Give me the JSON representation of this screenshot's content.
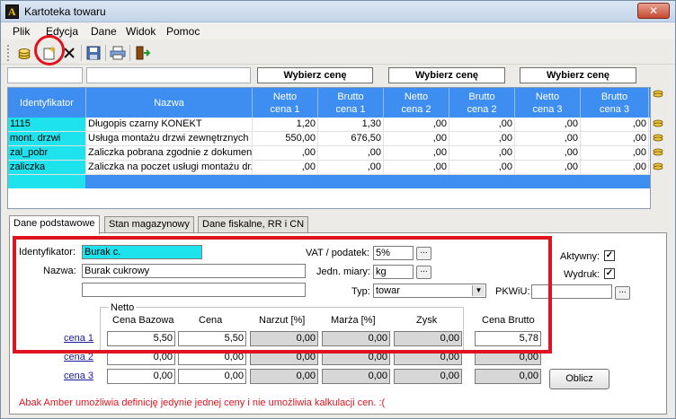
{
  "window": {
    "title": "Kartoteka towaru",
    "close_glyph": "✕"
  },
  "menu": [
    "Plik",
    "Edycja",
    "Dane",
    "Widok",
    "Pomoc"
  ],
  "toolbar": {
    "icons": [
      "coins-icon",
      "new-item-icon",
      "delete-icon",
      "save-icon",
      "print-icon",
      "exit-icon"
    ]
  },
  "price_buttons": [
    "Wybierz cenę",
    "Wybierz cenę",
    "Wybierz cenę"
  ],
  "grid": {
    "headers": [
      "Identyfikator",
      "Nazwa",
      "Netto\ncena 1",
      "Brutto\ncena 1",
      "Netto\ncena 2",
      "Brutto\ncena 2",
      "Netto\ncena 3",
      "Brutto\ncena 3"
    ],
    "rows": [
      [
        "1115",
        "Długopis czarny KONEKT",
        "1,20",
        "1,30",
        ",00",
        ",00",
        ",00",
        ",00"
      ],
      [
        "mont. drzwi",
        "Usługa montażu drzwi zewnętrznych",
        "550,00",
        "676,50",
        ",00",
        ",00",
        ",00",
        ",00"
      ],
      [
        "zal_pobr",
        "Zaliczka pobrana zgodnie z dokumente",
        ",00",
        ",00",
        ",00",
        ",00",
        ",00",
        ",00"
      ],
      [
        "zaliczka",
        "Zaliczka na poczet usługi montażu drzw",
        ",00",
        ",00",
        ",00",
        ",00",
        ",00",
        ",00"
      ]
    ]
  },
  "tabs": [
    "Dane podstawowe",
    "Stan magazynowy",
    "Dane fiskalne, RR i CN"
  ],
  "form": {
    "id_label": "Identyfikator:",
    "id_value": "Burak c.",
    "name_label": "Nazwa:",
    "name_value": "Burak cukrowy",
    "extra_value": "",
    "vat_label": "VAT / podatek:",
    "vat_value": "5%",
    "unit_label": "Jedn. miary:",
    "unit_value": "kg",
    "type_label": "Typ:",
    "type_value": "towar",
    "pkwiu_label": "PKWiU:",
    "pkwiu_value": "",
    "active_label": "Aktywny:",
    "print_label": "Wydruk:",
    "active_checked": true,
    "print_checked": true,
    "dots": "..."
  },
  "prices": {
    "group_label": "Netto",
    "headers": [
      "Cena Bazowa",
      "Cena",
      "Narzut [%]",
      "Marża [%]",
      "Zysk",
      "Cena Brutto"
    ],
    "rows": [
      {
        "label": "cena 1",
        "values": [
          "5,50",
          "5,50",
          "0,00",
          "0,00",
          "0,00",
          "5,78"
        ]
      },
      {
        "label": "cena 2",
        "values": [
          "0,00",
          "0,00",
          "0,00",
          "0,00",
          "0,00",
          "0,00"
        ]
      },
      {
        "label": "cena 3",
        "values": [
          "0,00",
          "0,00",
          "0,00",
          "0,00",
          "0,00",
          "0,00"
        ]
      }
    ]
  },
  "oblicz_label": "Oblicz",
  "footer_note": "Abak Amber umożliwia definicję jedynie jednej ceny i nie umożliwia kalkulacji cen. :(",
  "colors": {
    "header_blue": "#3d8ef0",
    "id_cyan": "#1ee3ec",
    "annotation_red": "#e0141e"
  }
}
